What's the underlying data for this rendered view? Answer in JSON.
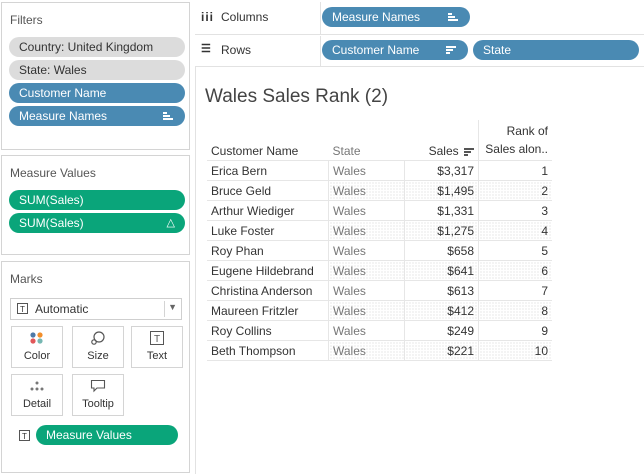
{
  "filters": {
    "title": "Filters",
    "items": [
      "Country: United Kingdom",
      "State: Wales",
      "Customer Name",
      "Measure Names"
    ]
  },
  "measure_values": {
    "title": "Measure Values",
    "items": [
      "SUM(Sales)",
      "SUM(Sales)"
    ],
    "delta_icon": "△"
  },
  "marks": {
    "title": "Marks",
    "type": "Automatic",
    "buttons": [
      "Color",
      "Size",
      "Text",
      "Detail",
      "Tooltip"
    ],
    "field": "Measure Values"
  },
  "shelves": {
    "columns_label": "Columns",
    "rows_label": "Rows",
    "columns_pill": "Measure Names",
    "rows_pills": [
      "Customer Name",
      "State"
    ]
  },
  "viz": {
    "title": "Wales Sales Rank (2)",
    "headers": {
      "customer": "Customer Name",
      "state": "State",
      "sales": "Sales",
      "rank_line1": "Rank of",
      "rank_line2": "Sales alon.."
    },
    "rows": [
      {
        "name": "Erica Bern",
        "state": "Wales",
        "sales": "$3,317",
        "rank": "1"
      },
      {
        "name": "Bruce Geld",
        "state": "Wales",
        "sales": "$1,495",
        "rank": "2"
      },
      {
        "name": "Arthur Wiediger",
        "state": "Wales",
        "sales": "$1,331",
        "rank": "3"
      },
      {
        "name": "Luke Foster",
        "state": "Wales",
        "sales": "$1,275",
        "rank": "4"
      },
      {
        "name": "Roy Phan",
        "state": "Wales",
        "sales": "$658",
        "rank": "5"
      },
      {
        "name": "Eugene Hildebrand",
        "state": "Wales",
        "sales": "$641",
        "rank": "6"
      },
      {
        "name": "Christina Anderson",
        "state": "Wales",
        "sales": "$613",
        "rank": "7"
      },
      {
        "name": "Maureen Fritzler",
        "state": "Wales",
        "sales": "$412",
        "rank": "8"
      },
      {
        "name": "Roy Collins",
        "state": "Wales",
        "sales": "$249",
        "rank": "9"
      },
      {
        "name": "Beth Thompson",
        "state": "Wales",
        "sales": "$221",
        "rank": "10"
      }
    ]
  },
  "colors": {
    "filter_pill_grey": "#dcdcdc",
    "dimension_blue": "#4a8ab3",
    "measure_green": "#0aa57a"
  },
  "icons": {
    "columns": "columns-icon",
    "rows": "rows-icon",
    "sort": "sort-descending-icon",
    "color": "color-dots-icon",
    "size": "size-icon",
    "text": "text-icon",
    "detail": "detail-dots-icon",
    "tooltip": "tooltip-icon"
  }
}
